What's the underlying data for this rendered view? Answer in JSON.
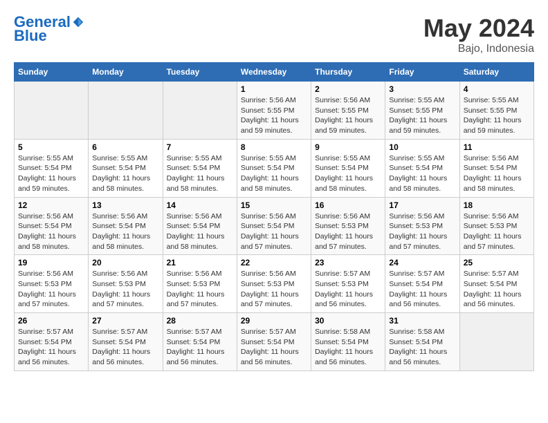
{
  "header": {
    "logo_line1": "General",
    "logo_line2": "Blue",
    "month": "May 2024",
    "location": "Bajo, Indonesia"
  },
  "weekdays": [
    "Sunday",
    "Monday",
    "Tuesday",
    "Wednesday",
    "Thursday",
    "Friday",
    "Saturday"
  ],
  "weeks": [
    [
      {
        "day": "",
        "info": ""
      },
      {
        "day": "",
        "info": ""
      },
      {
        "day": "",
        "info": ""
      },
      {
        "day": "1",
        "info": "Sunrise: 5:56 AM\nSunset: 5:55 PM\nDaylight: 11 hours\nand 59 minutes."
      },
      {
        "day": "2",
        "info": "Sunrise: 5:56 AM\nSunset: 5:55 PM\nDaylight: 11 hours\nand 59 minutes."
      },
      {
        "day": "3",
        "info": "Sunrise: 5:55 AM\nSunset: 5:55 PM\nDaylight: 11 hours\nand 59 minutes."
      },
      {
        "day": "4",
        "info": "Sunrise: 5:55 AM\nSunset: 5:55 PM\nDaylight: 11 hours\nand 59 minutes."
      }
    ],
    [
      {
        "day": "5",
        "info": "Sunrise: 5:55 AM\nSunset: 5:54 PM\nDaylight: 11 hours\nand 59 minutes."
      },
      {
        "day": "6",
        "info": "Sunrise: 5:55 AM\nSunset: 5:54 PM\nDaylight: 11 hours\nand 58 minutes."
      },
      {
        "day": "7",
        "info": "Sunrise: 5:55 AM\nSunset: 5:54 PM\nDaylight: 11 hours\nand 58 minutes."
      },
      {
        "day": "8",
        "info": "Sunrise: 5:55 AM\nSunset: 5:54 PM\nDaylight: 11 hours\nand 58 minutes."
      },
      {
        "day": "9",
        "info": "Sunrise: 5:55 AM\nSunset: 5:54 PM\nDaylight: 11 hours\nand 58 minutes."
      },
      {
        "day": "10",
        "info": "Sunrise: 5:55 AM\nSunset: 5:54 PM\nDaylight: 11 hours\nand 58 minutes."
      },
      {
        "day": "11",
        "info": "Sunrise: 5:56 AM\nSunset: 5:54 PM\nDaylight: 11 hours\nand 58 minutes."
      }
    ],
    [
      {
        "day": "12",
        "info": "Sunrise: 5:56 AM\nSunset: 5:54 PM\nDaylight: 11 hours\nand 58 minutes."
      },
      {
        "day": "13",
        "info": "Sunrise: 5:56 AM\nSunset: 5:54 PM\nDaylight: 11 hours\nand 58 minutes."
      },
      {
        "day": "14",
        "info": "Sunrise: 5:56 AM\nSunset: 5:54 PM\nDaylight: 11 hours\nand 58 minutes."
      },
      {
        "day": "15",
        "info": "Sunrise: 5:56 AM\nSunset: 5:54 PM\nDaylight: 11 hours\nand 57 minutes."
      },
      {
        "day": "16",
        "info": "Sunrise: 5:56 AM\nSunset: 5:53 PM\nDaylight: 11 hours\nand 57 minutes."
      },
      {
        "day": "17",
        "info": "Sunrise: 5:56 AM\nSunset: 5:53 PM\nDaylight: 11 hours\nand 57 minutes."
      },
      {
        "day": "18",
        "info": "Sunrise: 5:56 AM\nSunset: 5:53 PM\nDaylight: 11 hours\nand 57 minutes."
      }
    ],
    [
      {
        "day": "19",
        "info": "Sunrise: 5:56 AM\nSunset: 5:53 PM\nDaylight: 11 hours\nand 57 minutes."
      },
      {
        "day": "20",
        "info": "Sunrise: 5:56 AM\nSunset: 5:53 PM\nDaylight: 11 hours\nand 57 minutes."
      },
      {
        "day": "21",
        "info": "Sunrise: 5:56 AM\nSunset: 5:53 PM\nDaylight: 11 hours\nand 57 minutes."
      },
      {
        "day": "22",
        "info": "Sunrise: 5:56 AM\nSunset: 5:53 PM\nDaylight: 11 hours\nand 57 minutes."
      },
      {
        "day": "23",
        "info": "Sunrise: 5:57 AM\nSunset: 5:53 PM\nDaylight: 11 hours\nand 56 minutes."
      },
      {
        "day": "24",
        "info": "Sunrise: 5:57 AM\nSunset: 5:54 PM\nDaylight: 11 hours\nand 56 minutes."
      },
      {
        "day": "25",
        "info": "Sunrise: 5:57 AM\nSunset: 5:54 PM\nDaylight: 11 hours\nand 56 minutes."
      }
    ],
    [
      {
        "day": "26",
        "info": "Sunrise: 5:57 AM\nSunset: 5:54 PM\nDaylight: 11 hours\nand 56 minutes."
      },
      {
        "day": "27",
        "info": "Sunrise: 5:57 AM\nSunset: 5:54 PM\nDaylight: 11 hours\nand 56 minutes."
      },
      {
        "day": "28",
        "info": "Sunrise: 5:57 AM\nSunset: 5:54 PM\nDaylight: 11 hours\nand 56 minutes."
      },
      {
        "day": "29",
        "info": "Sunrise: 5:57 AM\nSunset: 5:54 PM\nDaylight: 11 hours\nand 56 minutes."
      },
      {
        "day": "30",
        "info": "Sunrise: 5:58 AM\nSunset: 5:54 PM\nDaylight: 11 hours\nand 56 minutes."
      },
      {
        "day": "31",
        "info": "Sunrise: 5:58 AM\nSunset: 5:54 PM\nDaylight: 11 hours\nand 56 minutes."
      },
      {
        "day": "",
        "info": ""
      }
    ]
  ]
}
